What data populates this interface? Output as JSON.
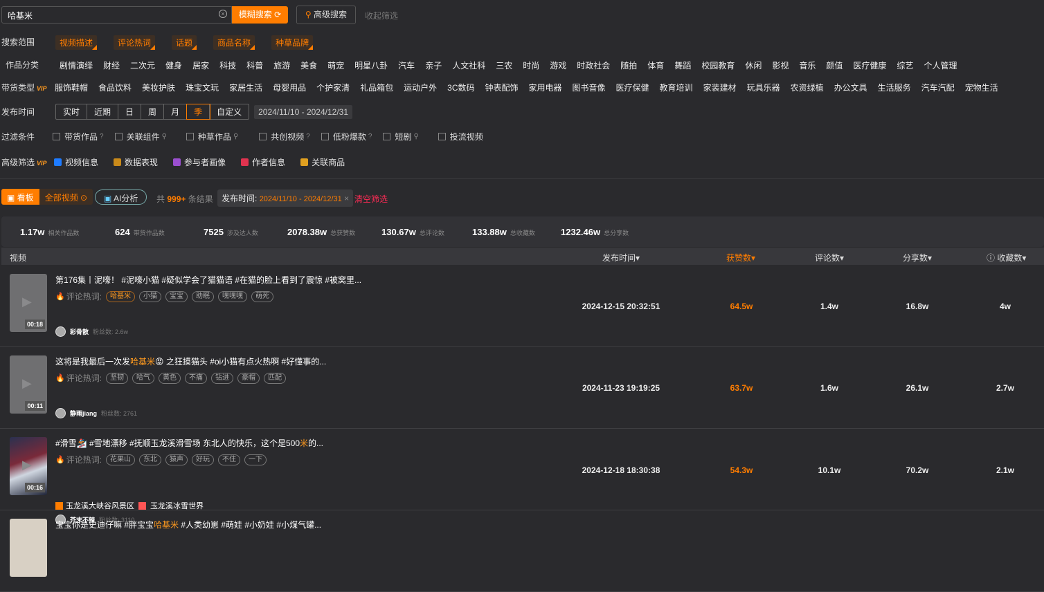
{
  "search": {
    "value": "哈基米",
    "fuzzy_btn": "模糊搜索 ⟳",
    "advanced_btn": "高级搜索",
    "collapse": "收起筛选"
  },
  "scope": {
    "label": "搜索范围",
    "items": [
      "视频描述",
      "评论热词",
      "话题",
      "商品名称",
      "种草品牌"
    ]
  },
  "category": {
    "label": "作品分类",
    "items": [
      "剧情演绎",
      "财经",
      "二次元",
      "健身",
      "居家",
      "科技",
      "科普",
      "旅游",
      "美食",
      "萌宠",
      "明星八卦",
      "汽车",
      "亲子",
      "人文社科",
      "三农",
      "时尚",
      "游戏",
      "时政社会",
      "随拍",
      "体育",
      "舞蹈",
      "校园教育",
      "休闲",
      "影视",
      "音乐",
      "颜值",
      "医疗健康",
      "综艺",
      "个人管理"
    ]
  },
  "goods": {
    "label": "带货类型",
    "vip": "VIP",
    "items": [
      "服饰鞋帽",
      "食品饮料",
      "美妆护肤",
      "珠宝文玩",
      "家居生活",
      "母婴用品",
      "个护家清",
      "礼品箱包",
      "运动户外",
      "3C数码",
      "钟表配饰",
      "家用电器",
      "图书音像",
      "医疗保健",
      "教育培训",
      "家装建材",
      "玩具乐器",
      "农资绿植",
      "办公文具",
      "生活服务",
      "汽车汽配",
      "宠物生活"
    ]
  },
  "time": {
    "label": "发布时间",
    "options": [
      "实时",
      "近期",
      "日",
      "周",
      "月",
      "季",
      "自定义"
    ],
    "selected": "季",
    "range": "2024/11/10 - 2024/12/31"
  },
  "filters": {
    "label": "过滤条件",
    "items": [
      "带货作品",
      "关联组件",
      "种草作品",
      "共创视频",
      "低粉爆款",
      "短剧",
      "投流视频"
    ]
  },
  "advanced": {
    "label": "高级筛选",
    "vip": "VIP",
    "items": [
      "视频信息",
      "数据表现",
      "参与者画像",
      "作者信息",
      "关联商品"
    ],
    "colors": [
      "#1e7bff",
      "#c98a1a",
      "#9b4fd0",
      "#e0334f",
      "#e0a020"
    ]
  },
  "toolbar": {
    "board": "看板",
    "all_videos": "全部视频",
    "ai": "AI分析",
    "result_prefix": "共",
    "result_count": "999+",
    "result_suffix": "条结果",
    "chip_label": "发布时间:",
    "chip_value": "2024/11/10 - 2024/12/31",
    "clear": "清空筛选"
  },
  "stats": [
    {
      "v": "1.17w",
      "l": "相关作品数"
    },
    {
      "v": "624",
      "l": "带货作品数"
    },
    {
      "v": "7525",
      "l": "涉及达人数"
    },
    {
      "v": "2078.38w",
      "l": "总获赞数"
    },
    {
      "v": "130.67w",
      "l": "总评论数"
    },
    {
      "v": "133.88w",
      "l": "总收藏数"
    },
    {
      "v": "1232.46w",
      "l": "总分享数"
    }
  ],
  "table": {
    "headers": {
      "video": "视频",
      "time": "发布时间▾",
      "likes": "获赞数▾",
      "comments": "评论数▾",
      "shares": "分享数▾",
      "favs": "ⓘ 收藏数▾"
    },
    "kw_label": "评论热词:",
    "rows": [
      {
        "dur": "00:18",
        "title_a": "第176集丨泥嚎！ #泥嚎小猫 #疑似学会了猫猫语 #在猫的脸上看到了震惊 #被窝里...",
        "title_hl": "",
        "title_b": "",
        "tags": [
          "哈基米",
          "小猫",
          "宝宝",
          "助眠",
          "嘿嘿嘿",
          "萌死"
        ],
        "author": "彩骨散",
        "fans": "粉丝数: 2.6w",
        "time": "2024-12-15 20:32:51",
        "likes": "64.5w",
        "comments": "1.4w",
        "shares": "16.8w",
        "favs": "4w"
      },
      {
        "dur": "00:11",
        "title_a": "这将是我最后一次发",
        "title_hl": "哈基米",
        "title_b": "😡 之狂摸猫头 #oi小猫有点火热啊 #好懂事的...",
        "tags": [
          "坚韧",
          "哈气",
          "黄色",
          "不痛",
          "钻进",
          "豪帽",
          "匹配"
        ],
        "author": "静雨jiang",
        "fans": "粉丝数: 2761",
        "time": "2024-11-23 19:19:25",
        "likes": "63.7w",
        "comments": "1.6w",
        "shares": "26.1w",
        "favs": "2.7w"
      },
      {
        "dur": "00:16",
        "title_a": "#滑雪🏂 #雪地漂移 #抚顺玉龙溪滑雪场 东北人的快乐，这个是500",
        "title_hl": "米",
        "title_b": "的...",
        "tags": [
          "花果山",
          "东北",
          "猿声",
          "好玩",
          "不住",
          "一下"
        ],
        "poi1": "玉龙溪大峡谷风景区",
        "poi2": "玉龙溪冰雪世界",
        "author": "芥末不辣",
        "fans": "粉丝数: 3110",
        "time": "2024-12-18 18:30:38",
        "likes": "54.3w",
        "comments": "10.1w",
        "shares": "70.2w",
        "favs": "2.1w"
      },
      {
        "title_a": "宝宝你是史迪仔嘛 #胖宝宝",
        "title_hl": "哈基米",
        "title_b": " #人类幼崽 #萌娃 #小奶娃 #小煤气罐..."
      }
    ]
  }
}
